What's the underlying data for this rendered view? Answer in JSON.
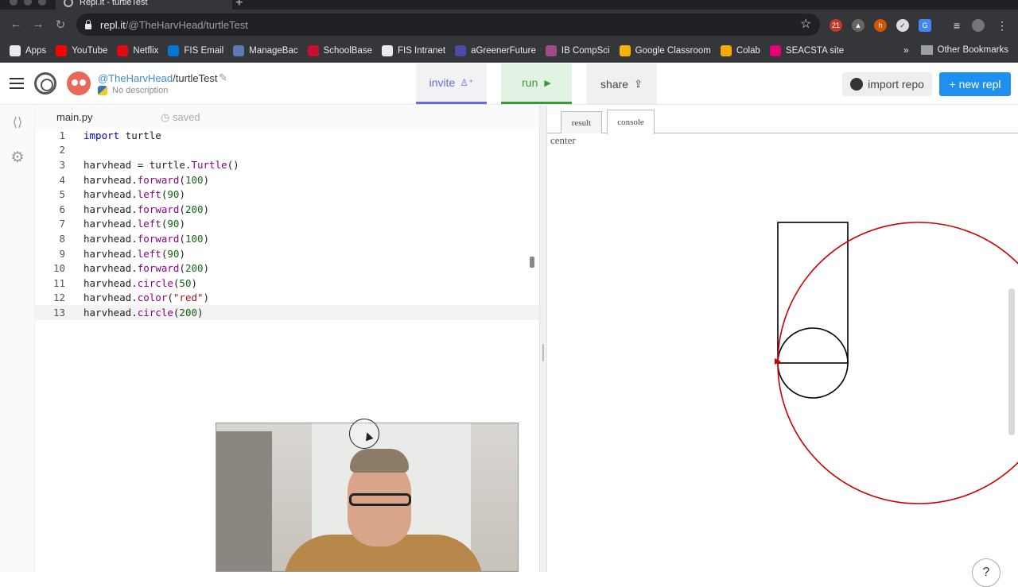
{
  "browser": {
    "tab_title": "Repl.it - turtleTest",
    "url_host": "repl.it",
    "url_path": "/@TheHarvHead/turtleTest",
    "extension_badge": "21",
    "bookmarks": [
      {
        "label": "Apps",
        "color": "#e8eaed",
        "icon": "apps-grid-icon"
      },
      {
        "label": "YouTube",
        "color": "#ff0000",
        "icon": "youtube-icon"
      },
      {
        "label": "Netflix",
        "color": "#e50914",
        "icon": "netflix-icon"
      },
      {
        "label": "FIS Email",
        "color": "#0078d4",
        "icon": "outlook-icon"
      },
      {
        "label": "ManageBac",
        "color": "#5a7ab5",
        "icon": "managebac-icon"
      },
      {
        "label": "SchoolBase",
        "color": "#c8102e",
        "icon": "schoolbase-icon"
      },
      {
        "label": "FIS Intranet",
        "color": "#e8eaed",
        "icon": "globe-icon"
      },
      {
        "label": "aGreenerFuture",
        "color": "#4a4aa8",
        "icon": "agreenerfuture-icon"
      },
      {
        "label": "IB CompSci",
        "color": "#a04a8a",
        "icon": "ibcompsci-icon"
      },
      {
        "label": "Google Classroom",
        "color": "#f4b400",
        "icon": "classroom-icon"
      },
      {
        "label": "Colab",
        "color": "#f9ab00",
        "icon": "colab-icon"
      },
      {
        "label": "SEACSTA site",
        "color": "#e20074",
        "icon": "seacsta-icon"
      }
    ],
    "more_bookmarks": "»",
    "other_bookmarks": "Other Bookmarks"
  },
  "header": {
    "user": "@TheHarvHead",
    "repl_name": "/turtleTest",
    "description": "No description",
    "invite_label": "invite",
    "run_label": "run",
    "share_label": "share",
    "import_label": "import repo",
    "new_repl_label": "+ new repl"
  },
  "editor": {
    "filename": "main.py",
    "status": "saved",
    "lines": [
      {
        "n": "1",
        "code": "import turtle"
      },
      {
        "n": "2",
        "code": ""
      },
      {
        "n": "3",
        "code": "harvhead = turtle.Turtle()"
      },
      {
        "n": "4",
        "code": "harvhead.forward(100)"
      },
      {
        "n": "5",
        "code": "harvhead.left(90)"
      },
      {
        "n": "6",
        "code": "harvhead.forward(200)"
      },
      {
        "n": "7",
        "code": "harvhead.left(90)"
      },
      {
        "n": "8",
        "code": "harvhead.forward(100)"
      },
      {
        "n": "9",
        "code": "harvhead.left(90)"
      },
      {
        "n": "10",
        "code": "harvhead.forward(200)"
      },
      {
        "n": "11",
        "code": "harvhead.circle(50)"
      },
      {
        "n": "12",
        "code": "harvhead.color(\"red\")"
      },
      {
        "n": "13",
        "code": "harvhead.circle(200)"
      }
    ]
  },
  "output": {
    "tab_result": "result",
    "tab_console": "console",
    "canvas_label": "center",
    "help_label": "?",
    "pen_color_1": "#000000",
    "pen_color_2": "#cc0000"
  }
}
